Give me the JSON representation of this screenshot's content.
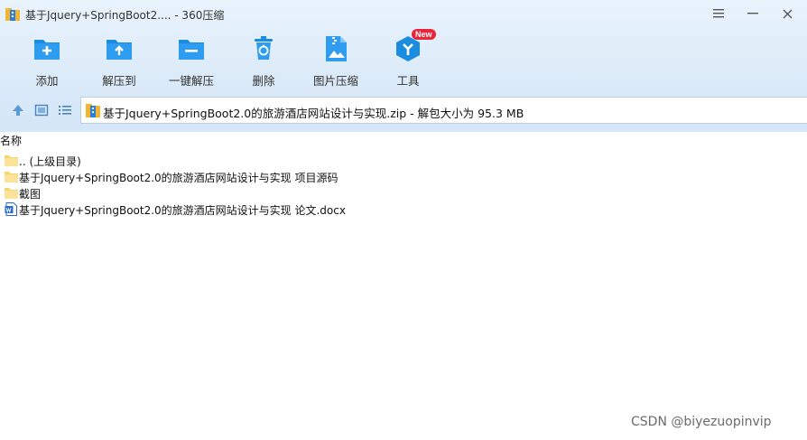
{
  "window": {
    "title": "基于Jquery+SpringBoot2.... - 360压缩"
  },
  "toolbar": {
    "items": [
      {
        "label": "添加",
        "icon": "folder-add-icon"
      },
      {
        "label": "解压到",
        "icon": "folder-extract-icon"
      },
      {
        "label": "一键解压",
        "icon": "folder-quick-extract-icon"
      },
      {
        "label": "删除",
        "icon": "trash-icon"
      },
      {
        "label": "图片压缩",
        "icon": "image-compress-icon"
      },
      {
        "label": "工具",
        "icon": "tools-icon",
        "badge": "New"
      }
    ]
  },
  "address": {
    "text": "基于Jquery+SpringBoot2.0的旅游酒店网站设计与实现.zip - 解包大小为 95.3 MB"
  },
  "list": {
    "column_name": "名称",
    "items": [
      {
        "name": ".. (上级目录)",
        "type": "folder"
      },
      {
        "name": "基于Jquery+SpringBoot2.0的旅游酒店网站设计与实现 项目源码",
        "type": "folder"
      },
      {
        "name": "截图",
        "type": "folder"
      },
      {
        "name": "基于Jquery+SpringBoot2.0的旅游酒店网站设计与实现 论文.docx",
        "type": "docx"
      }
    ]
  },
  "watermark": "CSDN @biyezuopinvip",
  "colors": {
    "accent": "#1a8de0",
    "badge": "#e8253a",
    "folder": "#f6d56b"
  }
}
